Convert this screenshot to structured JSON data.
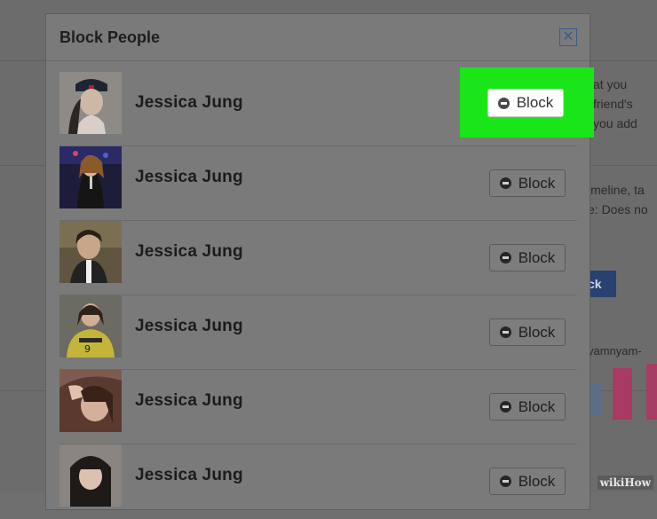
{
  "dialog": {
    "title": "Block People",
    "close_glyph": "✕",
    "block_label": "Block",
    "people": [
      {
        "name": "Jessica Jung",
        "highlighted": true
      },
      {
        "name": "Jessica Jung",
        "highlighted": false
      },
      {
        "name": "Jessica Jung",
        "highlighted": false
      },
      {
        "name": "Jessica Jung",
        "highlighted": false
      },
      {
        "name": "Jessica Jung",
        "highlighted": false
      },
      {
        "name": "Jessica Jung",
        "highlighted": false
      }
    ]
  },
  "background": {
    "text_block_1": "at you\nfriend's\nyou add",
    "text_block_2": "imeline, ta\ne: Does no",
    "button_label": "ck",
    "link_text": "yamnyam-"
  },
  "watermark": "wikiHow",
  "colors": {
    "highlight": "#19e619",
    "overlay_bg": "#6f6f6f",
    "dialog_bg": "#7a7a7a"
  }
}
